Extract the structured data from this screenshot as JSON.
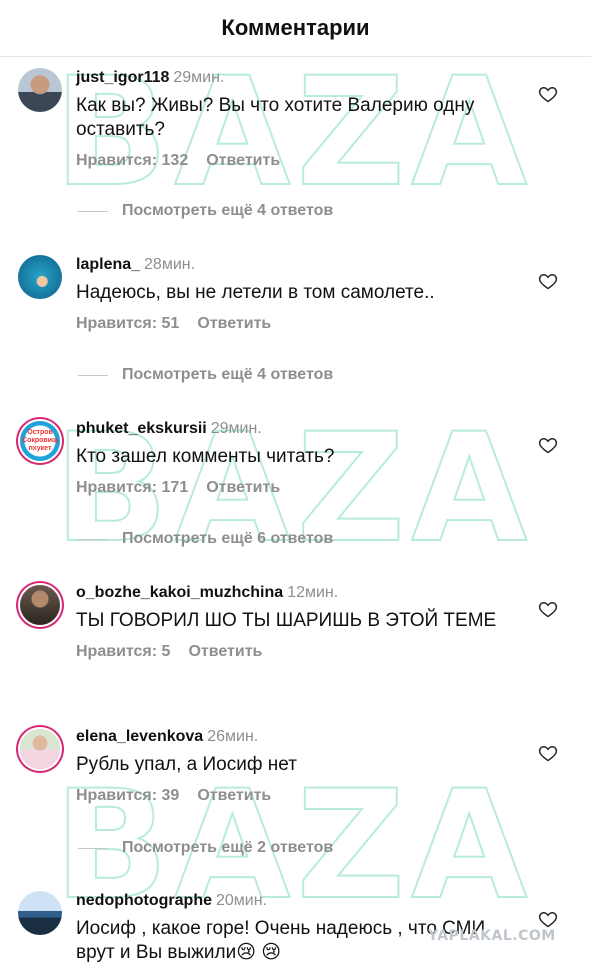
{
  "header": {
    "title": "Комментарии"
  },
  "watermark": {
    "text": "BAZA"
  },
  "corner_watermark": "YAPLAKAL.COM",
  "comments": [
    {
      "username": "just_igor118",
      "time": "29мин.",
      "text": "Как вы? Живы? Вы что хотите Валерию одну оставить?",
      "likes": "Нравится: 132",
      "reply": "Ответить",
      "view_replies": "Посмотреть ещё 4 ответов",
      "avatar": "user-photo"
    },
    {
      "username": "laplena_",
      "time": "28мин.",
      "text": "Надеюсь, вы не летели в том самолете..",
      "likes": "Нравится: 51",
      "reply": "Ответить",
      "view_replies": "Посмотреть ещё 4 ответов",
      "avatar": "user-photo"
    },
    {
      "username": "phuket_ekskursii",
      "time": "29мин.",
      "text": "Кто зашел комменты читать?",
      "likes": "Нравится: 171",
      "reply": "Ответить",
      "view_replies": "Посмотреть ещё 6 ответов",
      "avatar_logo_text": "Остров Сокровищ пхукет"
    },
    {
      "username": "o_bozhe_kakoi_muzhchina",
      "time": "12мин.",
      "text": "ТЫ ГОВОРИЛ ШО ТЫ ШАРИШЬ В ЭТОЙ ТЕМЕ",
      "likes": "Нравится: 5",
      "reply": "Ответить",
      "avatar": "user-photo"
    },
    {
      "username": "elena_levenkova",
      "time": "26мин.",
      "text": "Рубль упал, а Иосиф нет",
      "likes": "Нравится: 39",
      "reply": "Ответить",
      "view_replies": "Посмотреть ещё 2 ответов",
      "avatar": "user-photo"
    },
    {
      "username": "nedophotographe",
      "time": "20мин.",
      "text": "Иосиф , какое горе! Очень надеюсь , что СМИ врут и Вы выжили😢 😢",
      "avatar": "user-photo"
    }
  ]
}
